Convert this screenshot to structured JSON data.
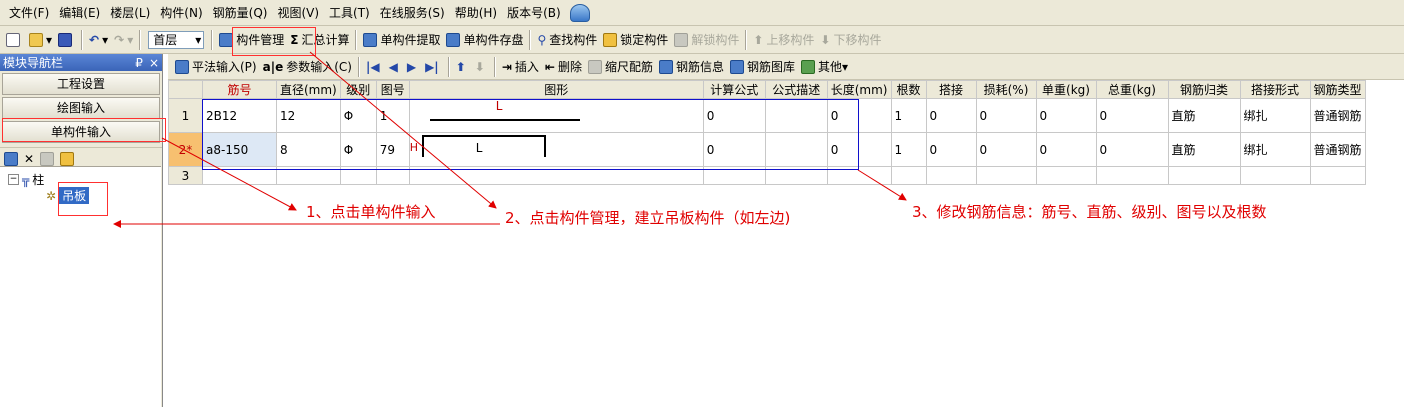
{
  "menubar": {
    "items": [
      "文件(F)",
      "编辑(E)",
      "楼层(L)",
      "构件(N)",
      "钢筋量(Q)",
      "视图(V)",
      "工具(T)",
      "在线服务(S)",
      "帮助(H)",
      "版本号(B)"
    ]
  },
  "toolbar1": {
    "floor": "首层",
    "component_manage": "构件管理",
    "sum_calc": "汇总计算",
    "single_extract": "单构件提取",
    "single_save": "单构件存盘",
    "find_component": "查找构件",
    "lock_component": "锁定构件",
    "unlock_component": "解锁构件",
    "move_up": "上移构件",
    "move_down": "下移构件"
  },
  "toolbar2": {
    "flat_input": "平法输入(P)",
    "param_input": "参数输入(C)",
    "insert": "插入",
    "delete": "删除",
    "scale_rebar": "缩尺配筋",
    "rebar_info": "钢筋信息",
    "rebar_library": "钢筋图库",
    "other": "其他"
  },
  "nav": {
    "title": "模块导航栏",
    "pin": "₽",
    "close": "×",
    "project_settings": "工程设置",
    "drawing_input": "绘图输入",
    "single_input": "单构件输入",
    "tree_root": "柱",
    "tree_child": "吊板"
  },
  "grid": {
    "columns": [
      "筋号",
      "直径(mm)",
      "级别",
      "图号",
      "图形",
      "计算公式",
      "公式描述",
      "长度(mm)",
      "根数",
      "搭接",
      "损耗(%)",
      "单重(kg)",
      "总重(kg)",
      "钢筋归类",
      "搭接形式",
      "钢筋类型"
    ],
    "rows": [
      {
        "num": "1",
        "bar": "2B12",
        "diameter": "12",
        "grade": "Φ",
        "shape_no": "1",
        "shape_label": "L",
        "formula": "0",
        "desc": "",
        "length": "0",
        "count": "1",
        "lap": "0",
        "loss": "0",
        "unit_weight": "0",
        "total_weight": "0",
        "category": "直筋",
        "lap_type": "绑扎",
        "rebar_type": "普通钢筋"
      },
      {
        "num": "2*",
        "bar": "a8-150",
        "diameter": "8",
        "grade": "Φ",
        "shape_no": "79",
        "shape_label": "L",
        "shape_h": "H",
        "formula": "0",
        "desc": "",
        "length": "0",
        "count": "1",
        "lap": "0",
        "loss": "0",
        "unit_weight": "0",
        "total_weight": "0",
        "category": "直筋",
        "lap_type": "绑扎",
        "rebar_type": "普通钢筋"
      },
      {
        "num": "3"
      }
    ]
  },
  "annotations": {
    "step1": "1、点击单构件输入",
    "step2": "2、点击构件管理，建立吊板构件（如左边)",
    "step3": "3、修改钢筋信息：筋号、直筋、级别、图号以及根数"
  },
  "colors": {
    "annotation": "#e00000",
    "highlight_box": "#1010cc"
  }
}
